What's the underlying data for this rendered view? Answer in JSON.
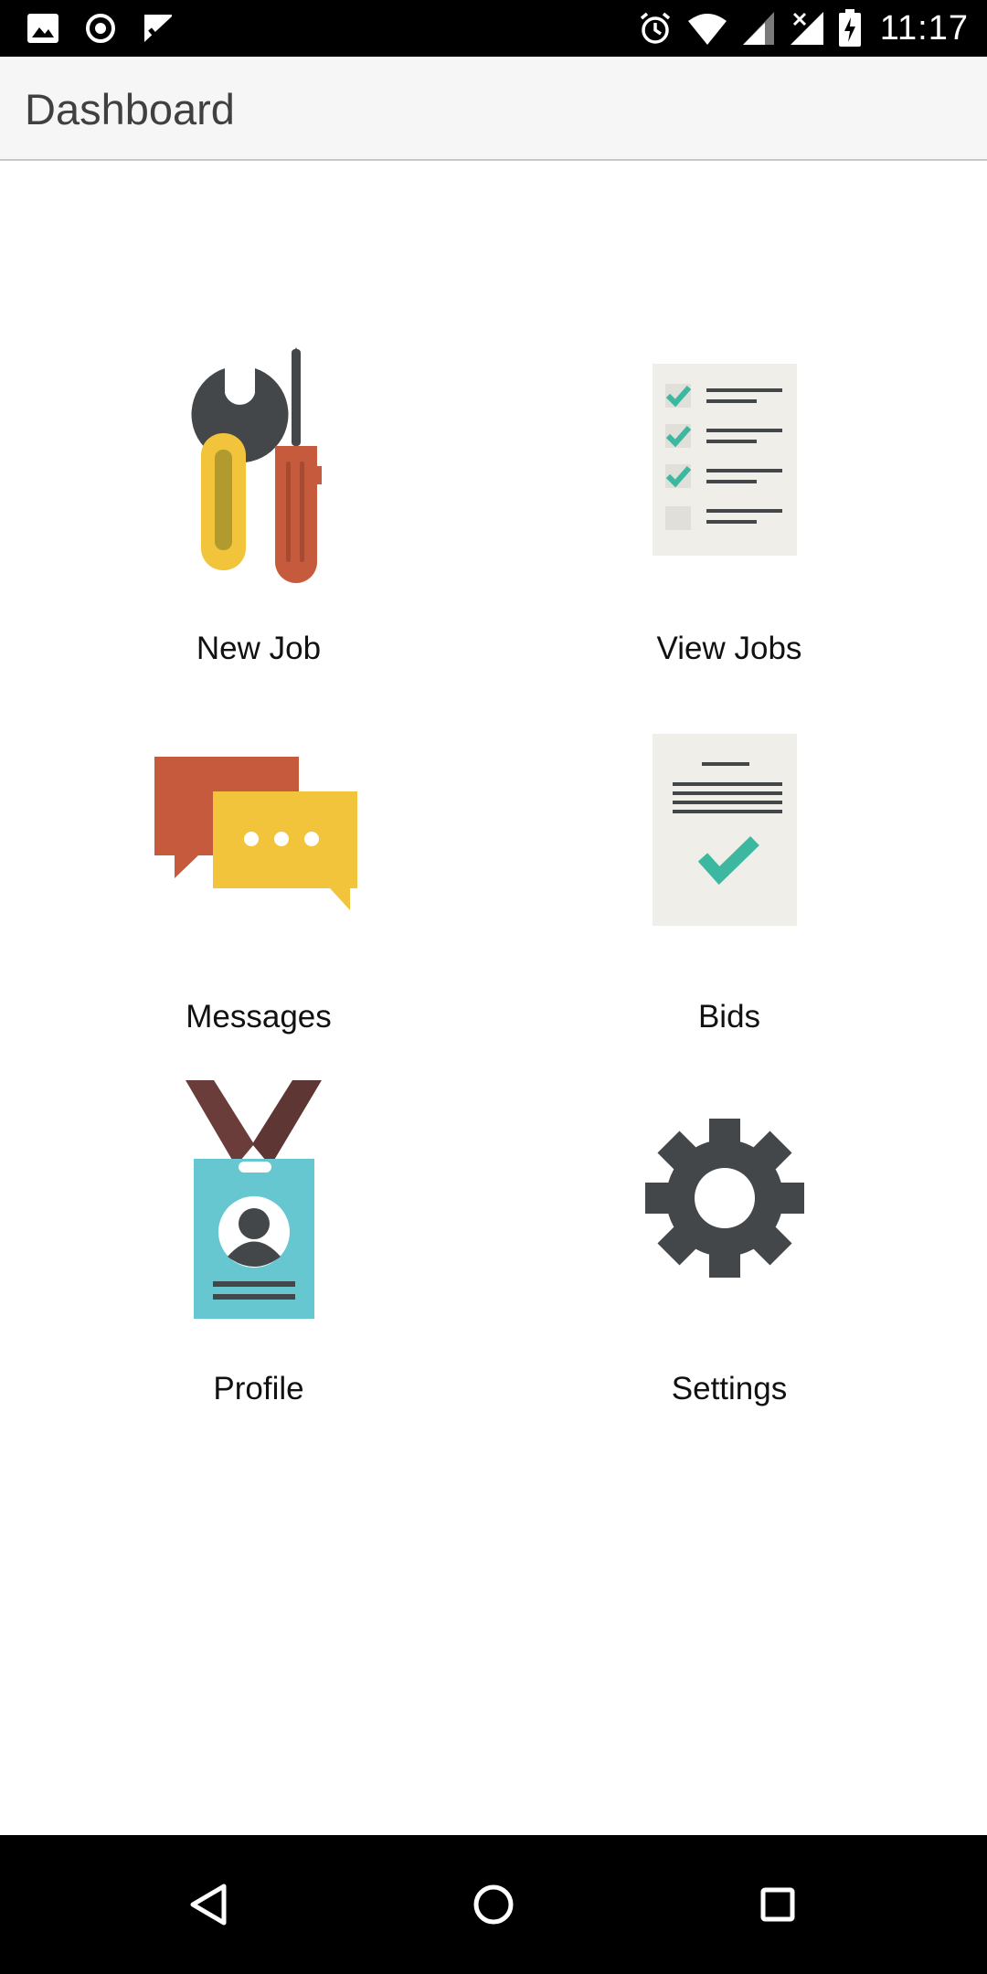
{
  "status_bar": {
    "time": "11:17",
    "left_icons": [
      "image-icon",
      "record-icon",
      "check-task-icon"
    ],
    "right_icons": [
      "alarm-icon",
      "wifi-icon",
      "signal-icon",
      "signal-no-data-icon",
      "battery-charging-icon"
    ]
  },
  "app_bar": {
    "title": "Dashboard"
  },
  "tiles": [
    {
      "label": "New Job",
      "icon": "tools-icon"
    },
    {
      "label": "View Jobs",
      "icon": "checklist-icon"
    },
    {
      "label": "Messages",
      "icon": "chat-bubbles-icon"
    },
    {
      "label": "Bids",
      "icon": "document-check-icon"
    },
    {
      "label": "Profile",
      "icon": "id-badge-icon"
    },
    {
      "label": "Settings",
      "icon": "gear-icon"
    }
  ],
  "colors": {
    "status_bar": "#000000",
    "app_bar": "#f6f6f6",
    "wrench_yellow": "#f2c43c",
    "tool_red": "#c55a3d",
    "dark_gray": "#434749",
    "teal_check": "#3db8a0",
    "badge_blue": "#66c7d0",
    "lanyard": "#6b3d3a"
  },
  "nav_bar": {
    "buttons": [
      "back-icon",
      "home-icon",
      "recents-icon"
    ]
  }
}
